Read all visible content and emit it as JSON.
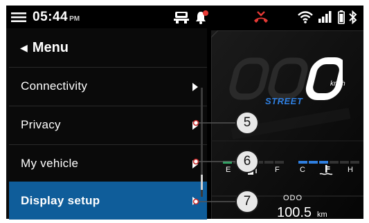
{
  "status_bar": {
    "time": "05:44",
    "ampm": "PM",
    "icons": [
      "hamburger-menu-icon",
      "vehicle-icon",
      "notification-bell-icon",
      "missed-call-icon",
      "wifi-icon",
      "signal-icon",
      "battery-icon",
      "bluetooth-icon"
    ]
  },
  "menu": {
    "title": "Menu",
    "items": [
      {
        "label": "Connectivity"
      },
      {
        "label": "Privacy"
      },
      {
        "label": "My vehicle"
      },
      {
        "label": "Display setup"
      }
    ],
    "active_item": "Display setup",
    "active_color": "#0f5d9a"
  },
  "dashboard": {
    "speed_unit": "km/h",
    "ride_mode": "STREET",
    "fuel_gauge": {
      "low_label": "E",
      "high_label": "F",
      "level_segments": 1,
      "total_segments": 6
    },
    "temp_gauge": {
      "low_label": "C",
      "high_label": "H",
      "level_segments": 3,
      "total_segments": 6
    },
    "odo": {
      "label": "ODO",
      "value": "100.5",
      "unit": "km"
    }
  },
  "callouts": [
    {
      "number": "5"
    },
    {
      "number": "6"
    },
    {
      "number": "7"
    }
  ],
  "colors": {
    "mode_blue": "#2f7fe0",
    "accent_red": "#e53935",
    "fuel_green": "#2fb36a"
  }
}
